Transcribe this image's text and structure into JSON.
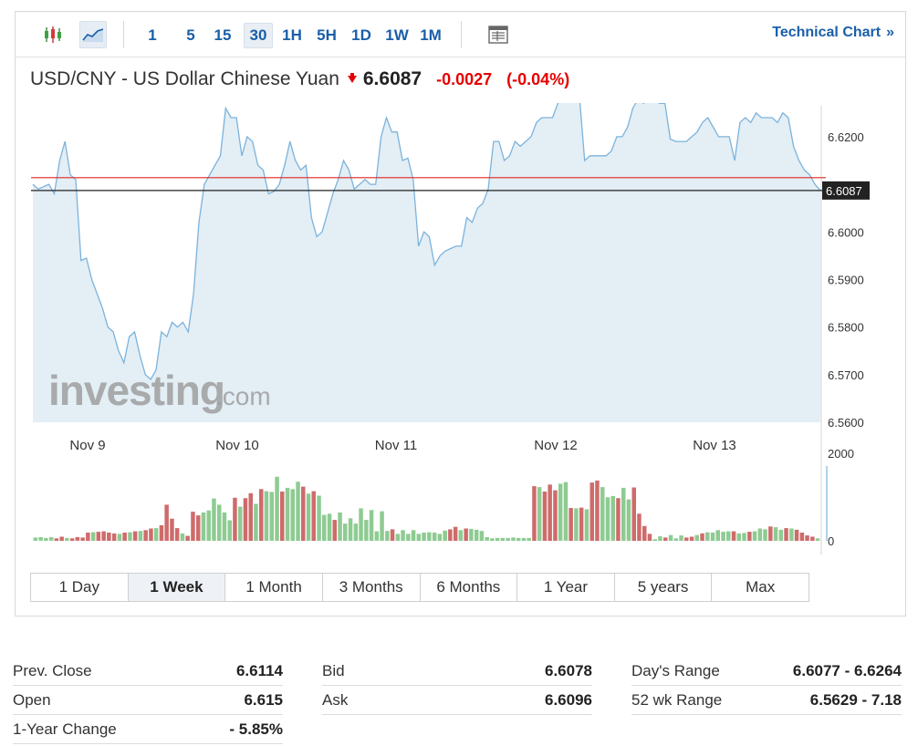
{
  "toolbar": {
    "timeframes": [
      "1",
      "5",
      "15",
      "30",
      "1H",
      "5H",
      "1D",
      "1W",
      "1M"
    ],
    "active_timeframe": "30",
    "technical_chart_label": "Technical Chart",
    "technical_chart_arrow": "»"
  },
  "header": {
    "pair": "USD/CNY - US Dollar Chinese Yuan",
    "last": "6.6087",
    "change": "-0.0027",
    "change_pct": "(-0.04%)",
    "direction": "down"
  },
  "colors": {
    "line": "#7bb3dc",
    "fill": "#e3eef5",
    "prev_close_line": "#e02424",
    "last_line": "#222222",
    "volume_up": "#8ecb92",
    "volume_down": "#cf6b6b"
  },
  "watermark": {
    "brand": "investing",
    "suffix": ".com"
  },
  "chart_data": {
    "type": "area",
    "x_labels": [
      "Nov 9",
      "Nov 10",
      "Nov 11",
      "Nov 12",
      "Nov 13"
    ],
    "y_ticks": [
      "6.6200",
      "6.6000",
      "6.5900",
      "6.5800",
      "6.5700",
      "6.5600"
    ],
    "ylim": [
      6.56,
      6.6265
    ],
    "prev_close": 6.6114,
    "last_value": 6.6087,
    "last_label": "6.6087",
    "grid": false,
    "values": [
      6.61,
      6.609,
      6.6095,
      6.61,
      6.608,
      6.615,
      6.619,
      6.612,
      6.611,
      6.594,
      6.5945,
      6.59,
      6.587,
      6.584,
      6.58,
      6.579,
      6.575,
      6.5725,
      6.578,
      6.579,
      6.574,
      6.57,
      6.569,
      6.571,
      6.579,
      6.578,
      6.581,
      6.58,
      6.581,
      6.579,
      6.587,
      6.602,
      6.61,
      6.612,
      6.614,
      6.616,
      6.626,
      6.624,
      6.624,
      6.616,
      6.62,
      6.619,
      6.614,
      6.613,
      6.608,
      6.6085,
      6.61,
      6.614,
      6.619,
      6.615,
      6.613,
      6.614,
      6.603,
      6.599,
      6.6,
      6.604,
      6.608,
      6.611,
      6.615,
      6.613,
      6.609,
      6.61,
      6.611,
      6.61,
      6.61,
      6.62,
      6.624,
      6.621,
      6.621,
      6.615,
      6.6155,
      6.611,
      6.597,
      6.6,
      6.599,
      6.593,
      6.595,
      6.596,
      6.5965,
      6.597,
      6.597,
      6.603,
      6.602,
      6.605,
      6.606,
      6.609,
      6.619,
      6.619,
      6.615,
      6.616,
      6.619,
      6.618,
      6.619,
      6.62,
      6.623,
      6.624,
      6.624,
      6.624,
      6.627,
      6.628,
      6.629,
      6.629,
      6.629,
      6.615,
      6.616,
      6.616,
      6.616,
      6.616,
      6.617,
      6.62,
      6.62,
      6.622,
      6.626,
      6.628,
      6.627,
      6.629,
      6.628,
      6.627,
      6.627,
      6.6195,
      6.619,
      6.619,
      6.619,
      6.62,
      6.621,
      6.623,
      6.624,
      6.622,
      6.62,
      6.62,
      6.62,
      6.615,
      6.623,
      6.624,
      6.623,
      6.625,
      6.624,
      6.624,
      6.624,
      6.623,
      6.625,
      6.624,
      6.618,
      6.615,
      6.613,
      6.612,
      6.61,
      6.6087
    ],
    "volume_max_label": "2000",
    "volume_min_label": "0",
    "volume": [
      [
        80,
        "up"
      ],
      [
        90,
        "up"
      ],
      [
        70,
        "up"
      ],
      [
        90,
        "up"
      ],
      [
        60,
        "down"
      ],
      [
        100,
        "down"
      ],
      [
        70,
        "up"
      ],
      [
        60,
        "down"
      ],
      [
        90,
        "down"
      ],
      [
        80,
        "down"
      ],
      [
        200,
        "down"
      ],
      [
        210,
        "up"
      ],
      [
        220,
        "down"
      ],
      [
        230,
        "down"
      ],
      [
        200,
        "down"
      ],
      [
        180,
        "down"
      ],
      [
        170,
        "up"
      ],
      [
        200,
        "down"
      ],
      [
        210,
        "up"
      ],
      [
        230,
        "down"
      ],
      [
        240,
        "up"
      ],
      [
        260,
        "down"
      ],
      [
        300,
        "down"
      ],
      [
        310,
        "up"
      ],
      [
        380,
        "down"
      ],
      [
        880,
        "down"
      ],
      [
        540,
        "down"
      ],
      [
        310,
        "down"
      ],
      [
        180,
        "up"
      ],
      [
        120,
        "down"
      ],
      [
        710,
        "down"
      ],
      [
        620,
        "down"
      ],
      [
        690,
        "up"
      ],
      [
        740,
        "up"
      ],
      [
        1030,
        "up"
      ],
      [
        880,
        "up"
      ],
      [
        690,
        "up"
      ],
      [
        500,
        "up"
      ],
      [
        1050,
        "down"
      ],
      [
        830,
        "up"
      ],
      [
        1040,
        "down"
      ],
      [
        1160,
        "down"
      ],
      [
        900,
        "up"
      ],
      [
        1260,
        "down"
      ],
      [
        1210,
        "up"
      ],
      [
        1190,
        "up"
      ],
      [
        1560,
        "up"
      ],
      [
        1200,
        "down"
      ],
      [
        1290,
        "up"
      ],
      [
        1260,
        "up"
      ],
      [
        1440,
        "up"
      ],
      [
        1320,
        "down"
      ],
      [
        1150,
        "up"
      ],
      [
        1210,
        "down"
      ],
      [
        1100,
        "up"
      ],
      [
        630,
        "up"
      ],
      [
        660,
        "up"
      ],
      [
        510,
        "down"
      ],
      [
        690,
        "up"
      ],
      [
        420,
        "up"
      ],
      [
        550,
        "up"
      ],
      [
        420,
        "up"
      ],
      [
        790,
        "up"
      ],
      [
        510,
        "up"
      ],
      [
        750,
        "up"
      ],
      [
        230,
        "up"
      ],
      [
        720,
        "up"
      ],
      [
        240,
        "up"
      ],
      [
        280,
        "down"
      ],
      [
        170,
        "up"
      ],
      [
        260,
        "up"
      ],
      [
        170,
        "up"
      ],
      [
        260,
        "up"
      ],
      [
        170,
        "up"
      ],
      [
        200,
        "up"
      ],
      [
        210,
        "up"
      ],
      [
        200,
        "up"
      ],
      [
        170,
        "up"
      ],
      [
        250,
        "up"
      ],
      [
        280,
        "down"
      ],
      [
        340,
        "down"
      ],
      [
        260,
        "up"
      ],
      [
        300,
        "down"
      ],
      [
        290,
        "up"
      ],
      [
        270,
        "up"
      ],
      [
        240,
        "up"
      ],
      [
        90,
        "up"
      ],
      [
        60,
        "up"
      ],
      [
        70,
        "up"
      ],
      [
        70,
        "up"
      ],
      [
        70,
        "up"
      ],
      [
        80,
        "up"
      ],
      [
        70,
        "up"
      ],
      [
        70,
        "up"
      ],
      [
        70,
        "up"
      ],
      [
        1330,
        "down"
      ],
      [
        1310,
        "up"
      ],
      [
        1200,
        "down"
      ],
      [
        1370,
        "down"
      ],
      [
        1230,
        "down"
      ],
      [
        1390,
        "up"
      ],
      [
        1430,
        "up"
      ],
      [
        800,
        "down"
      ],
      [
        790,
        "up"
      ],
      [
        810,
        "down"
      ],
      [
        770,
        "up"
      ],
      [
        1420,
        "down"
      ],
      [
        1470,
        "down"
      ],
      [
        1310,
        "up"
      ],
      [
        1060,
        "up"
      ],
      [
        1090,
        "up"
      ],
      [
        1040,
        "down"
      ],
      [
        1290,
        "up"
      ],
      [
        1010,
        "up"
      ],
      [
        1300,
        "down"
      ],
      [
        660,
        "down"
      ],
      [
        360,
        "down"
      ],
      [
        170,
        "down"
      ],
      [
        40,
        "up"
      ],
      [
        110,
        "up"
      ],
      [
        80,
        "down"
      ],
      [
        140,
        "up"
      ],
      [
        60,
        "up"
      ],
      [
        130,
        "up"
      ],
      [
        80,
        "down"
      ],
      [
        100,
        "down"
      ],
      [
        140,
        "up"
      ],
      [
        180,
        "down"
      ],
      [
        210,
        "up"
      ],
      [
        200,
        "up"
      ],
      [
        260,
        "up"
      ],
      [
        220,
        "up"
      ],
      [
        230,
        "up"
      ],
      [
        230,
        "down"
      ],
      [
        180,
        "up"
      ],
      [
        190,
        "up"
      ],
      [
        220,
        "down"
      ],
      [
        230,
        "up"
      ],
      [
        300,
        "up"
      ],
      [
        280,
        "up"
      ],
      [
        350,
        "down"
      ],
      [
        330,
        "up"
      ],
      [
        270,
        "up"
      ],
      [
        310,
        "down"
      ],
      [
        300,
        "up"
      ],
      [
        270,
        "down"
      ],
      [
        200,
        "down"
      ],
      [
        130,
        "down"
      ],
      [
        100,
        "down"
      ],
      [
        60,
        "up"
      ]
    ]
  },
  "range_tabs": [
    "1 Day",
    "1 Week",
    "1 Month",
    "3 Months",
    "6 Months",
    "1 Year",
    "5 years",
    "Max"
  ],
  "active_range": "1 Week",
  "stats": {
    "col1": [
      {
        "label": "Prev. Close",
        "value": "6.6114"
      },
      {
        "label": "Open",
        "value": "6.615"
      },
      {
        "label": "1-Year Change",
        "value": "- 5.85%"
      }
    ],
    "col2": [
      {
        "label": "Bid",
        "value": "6.6078"
      },
      {
        "label": "Ask",
        "value": "6.6096"
      }
    ],
    "col3": [
      {
        "label": "Day's Range",
        "value": "6.6077 - 6.6264"
      },
      {
        "label": "52 wk Range",
        "value": "6.5629 - 7.18"
      }
    ]
  }
}
